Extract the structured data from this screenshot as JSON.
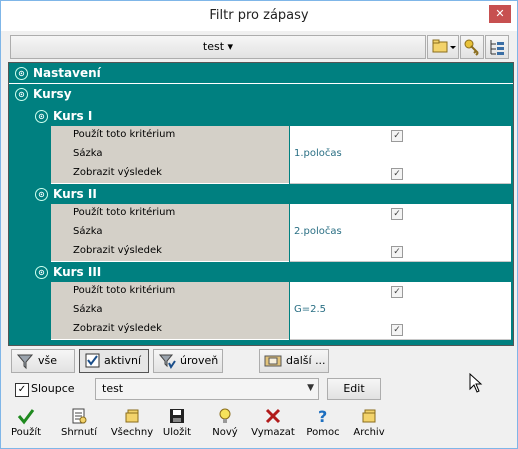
{
  "window": {
    "title": "Filtr pro zápasy",
    "close_label": "✕"
  },
  "toolbar": {
    "preset": "test ▾"
  },
  "grid": {
    "nastaveni": "Nastavení",
    "kursy": "Kursy",
    "groups": [
      {
        "title": "Kurs I",
        "rows": [
          {
            "name": "Použít toto kritérium",
            "value": "✓"
          },
          {
            "name": "Sázka",
            "value": "1.poločas"
          },
          {
            "name": "Zobrazit výsledek",
            "value": "✓"
          }
        ]
      },
      {
        "title": "Kurs II",
        "rows": [
          {
            "name": "Použít toto kritérium",
            "value": "✓"
          },
          {
            "name": "Sázka",
            "value": "2.poločas"
          },
          {
            "name": "Zobrazit výsledek",
            "value": "✓"
          }
        ]
      },
      {
        "title": "Kurs III",
        "rows": [
          {
            "name": "Použít toto kritérium",
            "value": "✓"
          },
          {
            "name": "Sázka",
            "value": "G=2.5"
          },
          {
            "name": "Zobrazit výsledek",
            "value": "✓"
          }
        ]
      }
    ]
  },
  "filterbar": {
    "vse": "vše",
    "aktivni": "aktivní",
    "uroven": "úroveň",
    "dalsi": "další ..."
  },
  "options": {
    "sloupce_label": "Sloupce",
    "sloupce_checked": "✓",
    "combo_value": "test",
    "edit_label": "Edit"
  },
  "bottom": {
    "pouzit": "Použít",
    "shrnuti": "Shrnutí",
    "vsechny": "Všechny",
    "ulozit": "Uložit",
    "novy": "Nový",
    "vymazat": "Vymazat",
    "pomoc": "Pomoc",
    "archiv": "Archiv"
  },
  "colors": {
    "accent": "#008080",
    "name_cell": "#d4d0c8",
    "value_text": "#2a6f84"
  }
}
